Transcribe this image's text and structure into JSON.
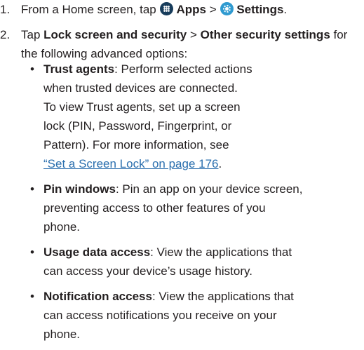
{
  "steps": [
    {
      "number": "1.",
      "prefix": "From a Home screen, tap ",
      "apps_label": "Apps",
      "separator": " > ",
      "settings_label": "Settings",
      "suffix": ".",
      "icons": [
        "apps-icon",
        "settings-icon"
      ]
    },
    {
      "number": "2.",
      "prefix": "Tap ",
      "item1": "Lock screen and security",
      "separator": " > ",
      "item2": "Other security settings",
      "suffix": " for the following advanced options:"
    }
  ],
  "options": [
    {
      "term": "Trust agents",
      "desc_lines": [
        ": Perform selected actions",
        "when trusted devices are connected.",
        "To view Trust agents, set up a screen",
        "lock (PIN, Password, Fingerprint, or",
        "Pattern). For more information, see"
      ],
      "link": "“Set a Screen Lock” on page 176",
      "link_suffix": "."
    },
    {
      "term": "Pin windows",
      "desc_lines": [
        ": Pin an app on your device screen,",
        "preventing access to other features of you",
        "phone."
      ]
    },
    {
      "term": "Usage data access",
      "desc_lines": [
        ": View the applications that",
        "can access your device’s usage history."
      ]
    },
    {
      "term": "Notification access",
      "desc_lines": [
        ": View the applications that",
        "can access notifications you receive on your",
        "phone."
      ]
    }
  ],
  "colors": {
    "text": "#231f20",
    "link": "#2b6fae",
    "apps_icon": "#173c5b",
    "settings_icon": "#2f9ad0"
  }
}
